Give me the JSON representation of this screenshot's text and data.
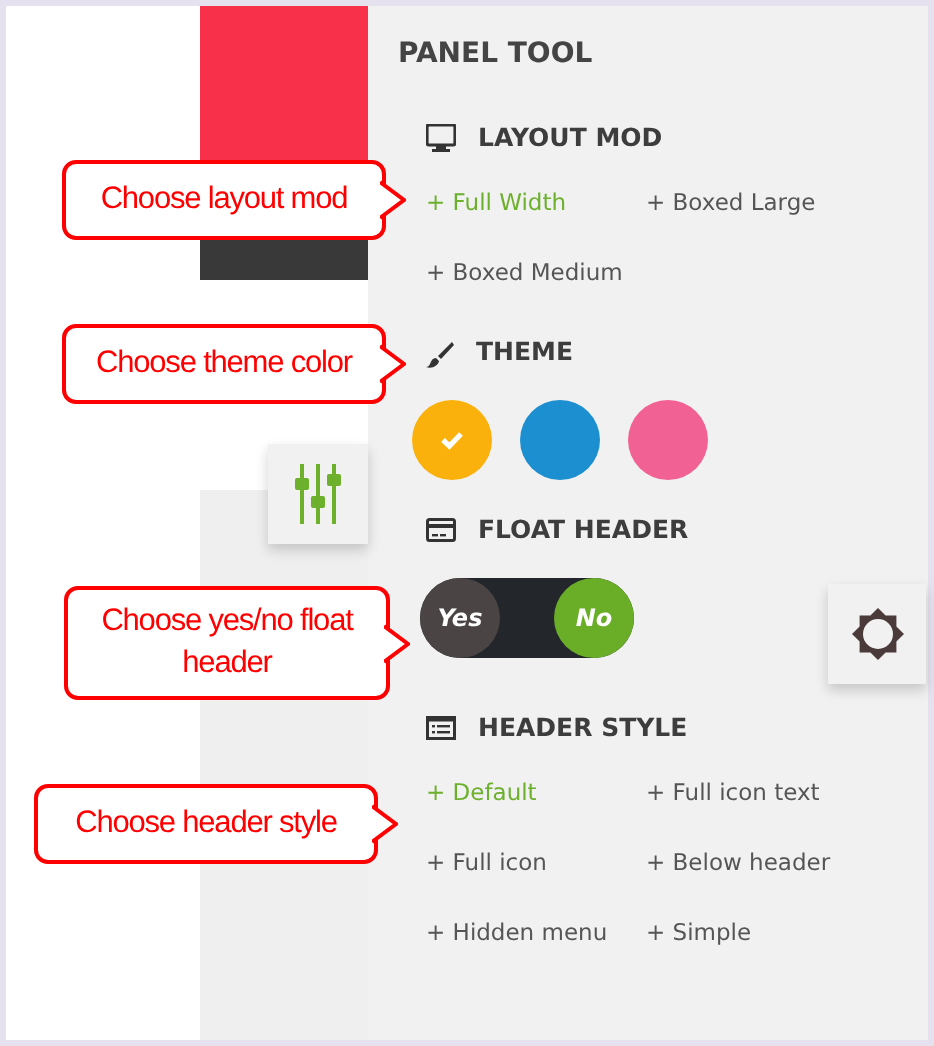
{
  "panel": {
    "title": "PANEL TOOL",
    "sections": [
      {
        "kind": "options",
        "title": "LAYOUT MOD",
        "options": [
          {
            "label": "+ Full Width",
            "selected": true
          },
          {
            "label": "+ Boxed Large",
            "selected": false
          },
          {
            "label": "+ Boxed Medium",
            "selected": false
          }
        ]
      },
      {
        "kind": "colors",
        "title": "THEME",
        "swatches": [
          {
            "color": "#fbb10b",
            "selected": true
          },
          {
            "color": "#1b8fd0",
            "selected": false
          },
          {
            "color": "#f26193",
            "selected": false
          }
        ]
      },
      {
        "kind": "toggle",
        "title": "FLOAT HEADER",
        "options": [
          {
            "label": "Yes",
            "selected": false
          },
          {
            "label": "No",
            "selected": true
          }
        ]
      },
      {
        "kind": "options",
        "title": "HEADER STYLE",
        "options": [
          {
            "label": "+ Default",
            "selected": true
          },
          {
            "label": "+ Full icon text",
            "selected": false
          },
          {
            "label": "+ Full icon",
            "selected": false
          },
          {
            "label": "+ Below header",
            "selected": false
          },
          {
            "label": "+ Hidden menu",
            "selected": false
          },
          {
            "label": "+ Simple",
            "selected": false
          }
        ]
      }
    ]
  },
  "callouts": [
    {
      "text": "Choose layout mod"
    },
    {
      "text": "Choose theme color"
    },
    {
      "text": "Choose yes/no float header"
    },
    {
      "text": "Choose header style"
    }
  ]
}
